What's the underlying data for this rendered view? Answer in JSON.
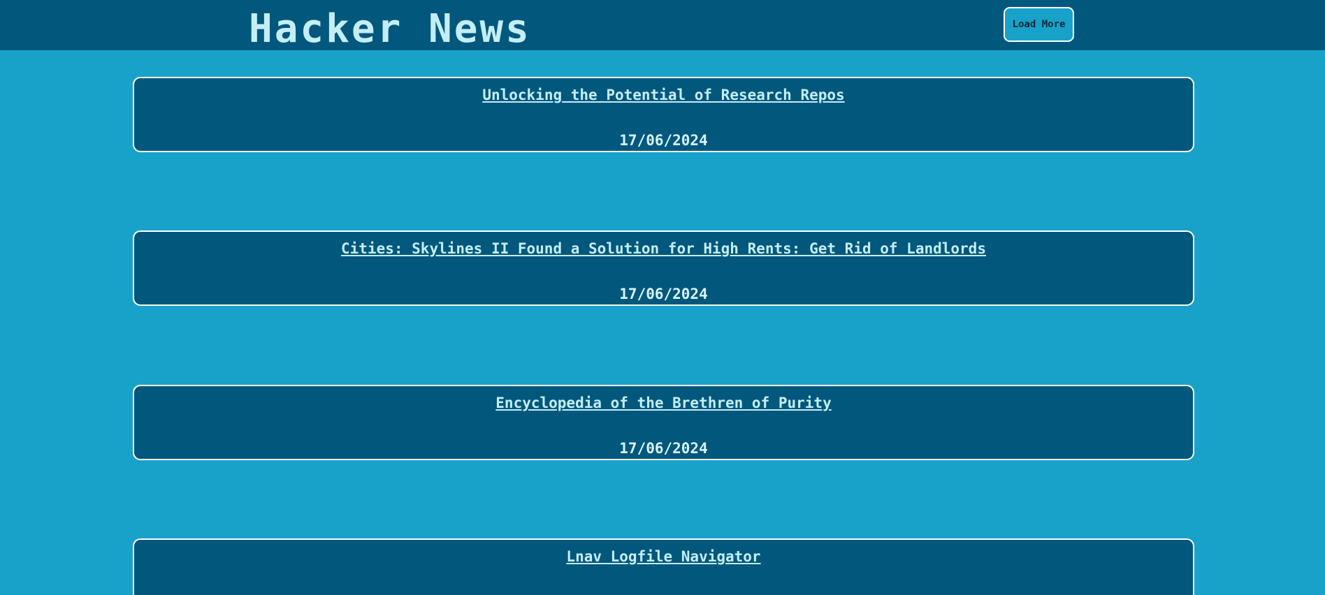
{
  "header": {
    "title": "Hacker News",
    "load_more_label": "Load More"
  },
  "colors": {
    "page_background": "#18a2ca",
    "header_background": "#02577d",
    "card_background": "#02577d",
    "title_text": "#c4eef7",
    "border": "#ffffff"
  },
  "stories": [
    {
      "title": "Unlocking the Potential of Research Repos",
      "date": "17/06/2024"
    },
    {
      "title": "Cities: Skylines II Found a Solution for High Rents: Get Rid of Landlords",
      "date": "17/06/2024"
    },
    {
      "title": "Encyclopedia of the Brethren of Purity",
      "date": "17/06/2024"
    },
    {
      "title": "Lnav Logfile Navigator",
      "date": ""
    }
  ]
}
